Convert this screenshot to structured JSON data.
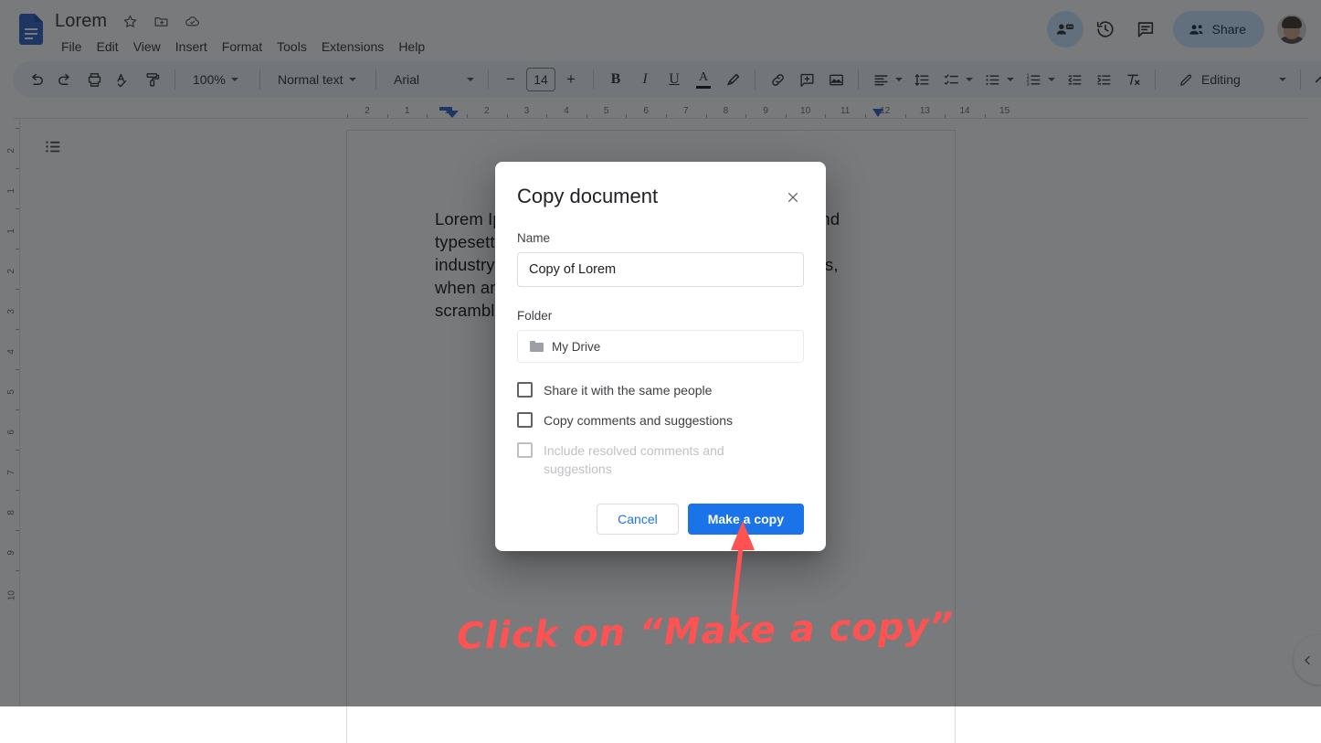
{
  "app": {
    "doc_title": "Lorem",
    "title_icons": [
      "star-icon",
      "move-to-folder-icon",
      "cloud-saved-icon"
    ],
    "menus": [
      "File",
      "Edit",
      "View",
      "Insert",
      "Format",
      "Tools",
      "Extensions",
      "Help"
    ],
    "header_actions": {
      "present_label": "present-icon",
      "history_label": "version-history-icon",
      "comments_label": "comments-icon",
      "share_label": "Share",
      "avatar_label": "avatar"
    }
  },
  "toolbar": {
    "undo": "undo-icon",
    "redo": "redo-icon",
    "print": "print-icon",
    "spellcheck": "spellcheck-icon",
    "paint_format": "paint-format-icon",
    "zoom_value": "100%",
    "style_value": "Normal text",
    "font_value": "Arial",
    "font_size_value": "14",
    "decrease_font": "−",
    "increase_font": "+",
    "bold": "B",
    "italic": "I",
    "underline": "U",
    "text_color": "A",
    "highlight": "highlight-icon",
    "link": "link-icon",
    "comment": "add-comment-icon",
    "image": "insert-image-icon",
    "align": "align-icon",
    "line_spacing": "line-spacing-icon",
    "checklist": "checklist-icon",
    "bulleted_list": "bulleted-list-icon",
    "numbered_list": "numbered-list-icon",
    "decrease_indent": "decrease-indent-icon",
    "increase_indent": "increase-indent-icon",
    "clear_formatting": "clear-formatting-icon",
    "mode_value": "Editing",
    "collapse": "collapse-toolbar-icon"
  },
  "ruler": {
    "h_labels": [
      "2",
      "1",
      "1",
      "2",
      "3",
      "4",
      "5",
      "6",
      "7",
      "8",
      "9",
      "10",
      "11",
      "12",
      "13",
      "14",
      "15"
    ],
    "v_labels": [
      "2",
      "1",
      "1",
      "2",
      "3",
      "4",
      "5",
      "6",
      "7",
      "8",
      "9",
      "10"
    ]
  },
  "document": {
    "outline_icon": "document-outline-icon",
    "paragraph": "Lorem Ipsum is simply dummy text of the printing and typesetting industry. Lorem Ipsum has been the industry's standard dummy text ever since the 1500s, when an unknown printer took a galley of type and scrambled it to make a type specimen book."
  },
  "collapse_pill": {
    "icon": "chevron-left-icon"
  },
  "dialog": {
    "title": "Copy document",
    "close_icon": "close-icon",
    "name_label": "Name",
    "name_value": "Copy of Lorem",
    "folder_label": "Folder",
    "folder_value": "My Drive",
    "checkboxes": [
      {
        "label": "Share it with the same people",
        "checked": false,
        "disabled": false
      },
      {
        "label": "Copy comments and suggestions",
        "checked": false,
        "disabled": false
      },
      {
        "label": "Include resolved comments and suggestions",
        "checked": false,
        "disabled": true
      }
    ],
    "cancel_label": "Cancel",
    "primary_label": "Make a copy"
  },
  "annotation": {
    "text": "Click on “Make a copy”",
    "color": "#ff5252"
  },
  "colors": {
    "primary_blue": "#1a73e8",
    "toolbar_bg": "#edf2fa",
    "share_bg": "#c2e7ff",
    "annotation_red": "#ff5252"
  }
}
